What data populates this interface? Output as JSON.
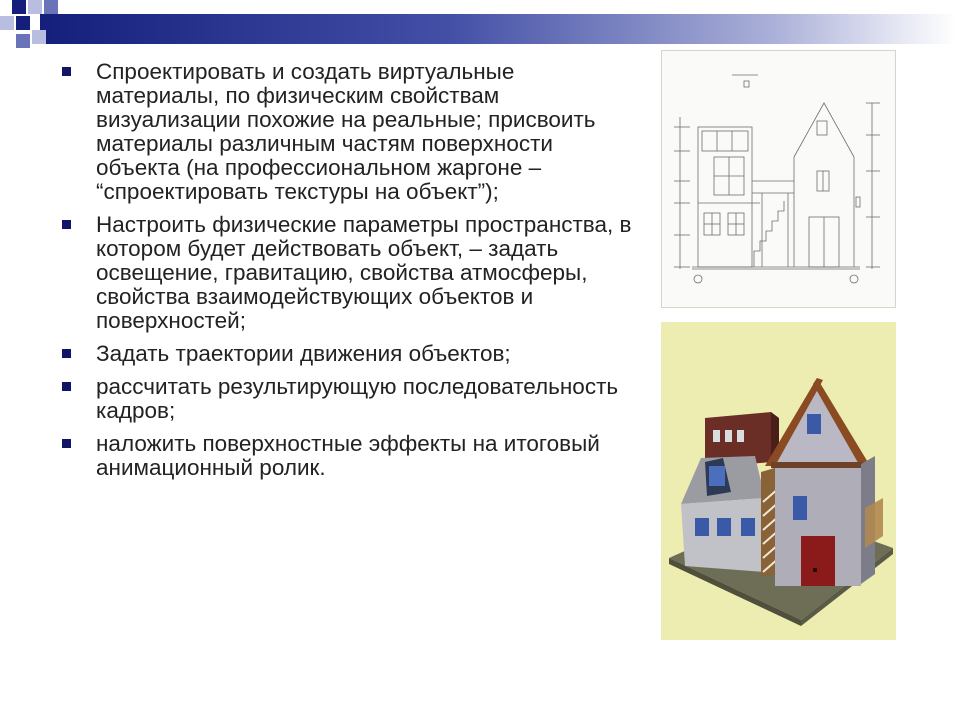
{
  "decor": {
    "bar_color": "#141f7c",
    "square_colors": [
      "#141f7c",
      "#6b73b8",
      "#b9bde0"
    ]
  },
  "bullets": [
    {
      "text": "Спроектировать и создать виртуальные материалы, по физическим свойствам визуализации похожие на реальные; присвоить материалы различным частям поверхности объекта (на профессиональном жаргоне – “спроектировать текстуры на объект”);"
    },
    {
      "text": "Настроить физические параметры пространства, в котором будет действовать объект, – задать освещение, гравитацию, свойства атмосферы, свойства взаимодействующих объектов и поверхностей;"
    },
    {
      "text": "Задать траектории движения объектов;"
    },
    {
      "text": "рассчитать результирующую последовательность кадров;"
    },
    {
      "text": "наложить поверхностные эффекты на итоговый анимационный ролик."
    }
  ]
}
